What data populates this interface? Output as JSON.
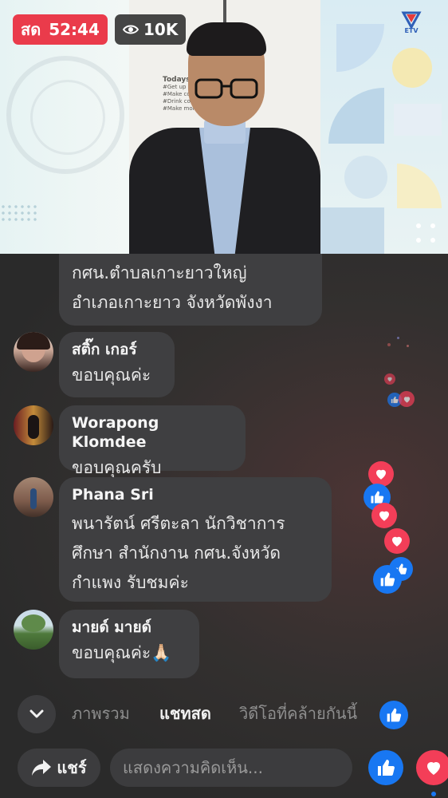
{
  "live_badge": {
    "label": "สด",
    "timer": "52:44"
  },
  "viewers": {
    "count": "10K",
    "icon": "eye-icon"
  },
  "channel_logo": {
    "text": "ETV"
  },
  "video": {
    "wall_note": [
      "Todays",
      "#Get up",
      "#Make coff",
      "#Drink coff",
      "#Make more"
    ]
  },
  "comments": [
    {
      "author": "",
      "message": "กศน.ตำบลเกาะยาวใหญ่\nอำเภอเกาะยาว  จังหวัดพังงา"
    },
    {
      "author": "สติ๊ก เกอร์",
      "message": "ขอบคุณค่ะ"
    },
    {
      "author": "Worapong Klomdee",
      "message": "ขอบคุณครับ"
    },
    {
      "author": "Phana Sri",
      "message": "พนารัตน์  ศรีตะลา นักวิชาการ\nศึกษา สำนักงาน กศน.จังหวัด\nกำแพง รับชมค่ะ"
    },
    {
      "author": "มายด์ มายด์",
      "message": "ขอบคุณค่ะ🙏🏻"
    }
  ],
  "tabs": [
    {
      "label": "ภาพรวม",
      "active": false
    },
    {
      "label": "แชทสด",
      "active": true
    },
    {
      "label": "วิดีโอที่คล้ายกันนี้",
      "active": false
    }
  ],
  "footer": {
    "share_label": "แชร์",
    "comment_placeholder": "แสดงความคิดเห็น..."
  },
  "colors": {
    "live_red": "#ea3b4b",
    "like_blue": "#1877f2",
    "love_red": "#f33e58",
    "bubble_bg": "#3f3f41"
  }
}
